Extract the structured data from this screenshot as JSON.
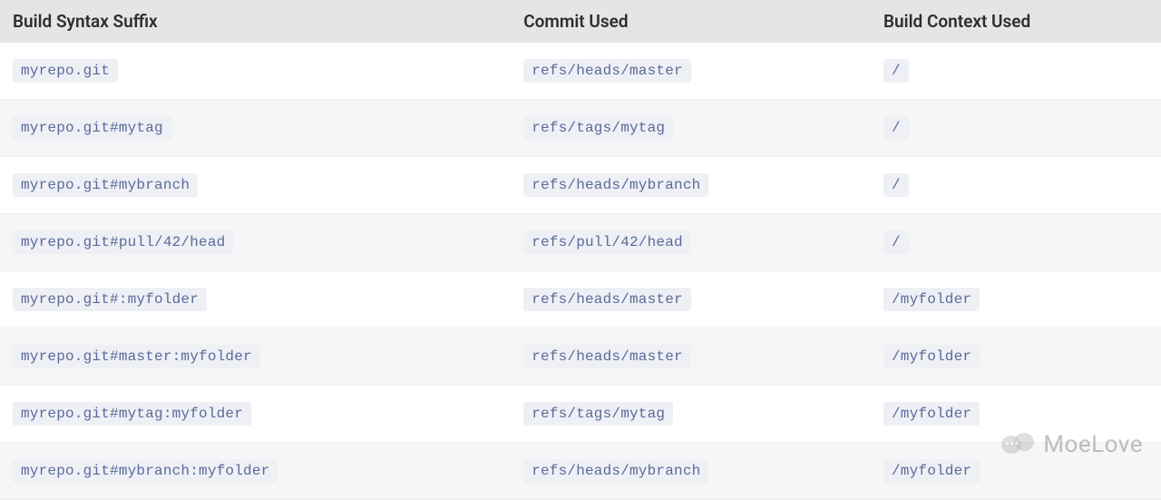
{
  "headers": {
    "col1": "Build Syntax Suffix",
    "col2": "Commit Used",
    "col3": "Build Context Used"
  },
  "rows": [
    {
      "suffix": "myrepo.git",
      "commit": "refs/heads/master",
      "context": "/"
    },
    {
      "suffix": "myrepo.git#mytag",
      "commit": "refs/tags/mytag",
      "context": "/"
    },
    {
      "suffix": "myrepo.git#mybranch",
      "commit": "refs/heads/mybranch",
      "context": "/"
    },
    {
      "suffix": "myrepo.git#pull/42/head",
      "commit": "refs/pull/42/head",
      "context": "/"
    },
    {
      "suffix": "myrepo.git#:myfolder",
      "commit": "refs/heads/master",
      "context": "/myfolder"
    },
    {
      "suffix": "myrepo.git#master:myfolder",
      "commit": "refs/heads/master",
      "context": "/myfolder"
    },
    {
      "suffix": "myrepo.git#mytag:myfolder",
      "commit": "refs/tags/mytag",
      "context": "/myfolder"
    },
    {
      "suffix": "myrepo.git#mybranch:myfolder",
      "commit": "refs/heads/mybranch",
      "context": "/myfolder"
    }
  ],
  "watermark": "MoeLove"
}
